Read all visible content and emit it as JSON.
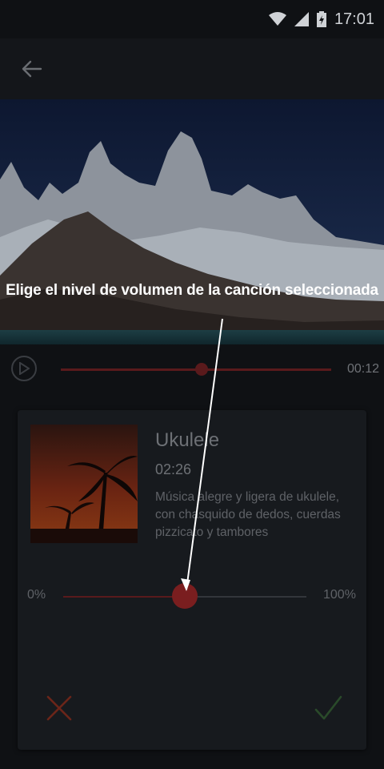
{
  "status_bar": {
    "time": "17:01",
    "icons": [
      "wifi-icon",
      "signal-icon",
      "battery-icon"
    ]
  },
  "app_bar": {
    "back_icon": "arrow-left-icon"
  },
  "hero": {
    "image": "mountain-lake-landscape"
  },
  "player": {
    "play_icon": "play-icon",
    "elapsed": "00:12",
    "progress": 0.52
  },
  "song": {
    "title": "Ukulele",
    "duration": "02:26",
    "description": "Música alegre y ligera de ukulele, con chasquido de dedos, cuerdas pizzicato y tambores",
    "art": "palm-tree-sunset"
  },
  "volume": {
    "min_label": "0%",
    "max_label": "100%",
    "level": 0.5
  },
  "actions": {
    "cancel_icon": "close-icon",
    "confirm_icon": "check-icon"
  },
  "tutorial": {
    "text": "Elige el nivel de volumen de la canción seleccionada"
  },
  "colors": {
    "accent": "#7a1e1f",
    "background": "#0f1114",
    "card": "#171a1e",
    "cancel": "#6b2519",
    "confirm": "#2a4a2a"
  }
}
